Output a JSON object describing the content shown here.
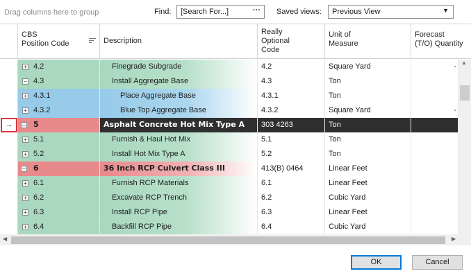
{
  "toolbar": {
    "group_hint": "Drag columns here to group",
    "find_label": "Find:",
    "find_placeholder": "[Search For...]",
    "find_dots": "···",
    "saved_views_label": "Saved views:",
    "saved_view_value": "Previous View"
  },
  "columns": {
    "code": [
      "CBS",
      "Position Code"
    ],
    "description": "Description",
    "optional": [
      "Really",
      "Optional",
      "Code"
    ],
    "unit": [
      "Unit of",
      "Measure"
    ],
    "forecast": [
      "Forecast",
      "(T/O) Quantity"
    ]
  },
  "rows": [
    {
      "code": "4.2",
      "description": "Finegrade Subgrade",
      "optional": "4.2",
      "unit": "Square Yard",
      "color": "green",
      "level": 1,
      "expander": "+",
      "forecast_mark": "-"
    },
    {
      "code": "4.3",
      "description": "Install Aggregate Base",
      "optional": "4.3",
      "unit": "Ton",
      "color": "green",
      "level": 1,
      "expander": "−",
      "forecast_mark": ""
    },
    {
      "code": "4.3.1",
      "description": "Place Aggregate Base",
      "optional": "4.3.1",
      "unit": "Ton",
      "color": "blue",
      "level": 2,
      "expander": "+",
      "forecast_mark": ""
    },
    {
      "code": "4.3.2",
      "description": "Blue Top Aggregate Base",
      "optional": "4.3.2",
      "unit": "Square Yard",
      "color": "blue",
      "level": 2,
      "expander": "+",
      "forecast_mark": "-"
    },
    {
      "code": "5",
      "description": "Asphalt Concrete Hot Mix Type A",
      "optional": "303 4263",
      "unit": "Ton",
      "color": "red",
      "level": 0,
      "expander": "−",
      "selected": true,
      "bold": true,
      "forecast_mark": ""
    },
    {
      "code": "5.1",
      "description": "Furnish & Haul Hot Mix",
      "optional": "5.1",
      "unit": "Ton",
      "color": "green",
      "level": 1,
      "expander": "+",
      "forecast_mark": ""
    },
    {
      "code": "5.2",
      "description": "Install Hot Mix Type A",
      "optional": "5.2",
      "unit": "Ton",
      "color": "green",
      "level": 1,
      "expander": "+",
      "forecast_mark": ""
    },
    {
      "code": "6",
      "description": "36 Inch RCP Culvert Class III",
      "optional": "413(B) 0464",
      "unit": "Linear Feet",
      "color": "red",
      "level": 0,
      "expander": "−",
      "bold": true,
      "forecast_mark": ""
    },
    {
      "code": "6.1",
      "description": "Furnish RCP Materials",
      "optional": "6.1",
      "unit": "Linear Feet",
      "color": "green",
      "level": 1,
      "expander": "+",
      "forecast_mark": ""
    },
    {
      "code": "6.2",
      "description": "Excavate RCP Trench",
      "optional": "6.2",
      "unit": "Cubic Yard",
      "color": "green",
      "level": 1,
      "expander": "+",
      "forecast_mark": ""
    },
    {
      "code": "6.3",
      "description": "Install RCP Pipe",
      "optional": "6.3",
      "unit": "Linear Feet",
      "color": "green",
      "level": 1,
      "expander": "+",
      "forecast_mark": ""
    },
    {
      "code": "6.4",
      "description": "Backfill RCP Pipe",
      "optional": "6.4",
      "unit": "Cubic Yard",
      "color": "green",
      "level": 1,
      "expander": "+",
      "forecast_mark": ""
    }
  ],
  "row_indicator": "→",
  "buttons": {
    "ok": "OK",
    "cancel": "Cancel"
  },
  "colors": {
    "green": "#a9d8bf",
    "blue": "#97cbe9",
    "red": "#e8898c",
    "selected": "#2f2f2f",
    "focus": "#0078d7"
  }
}
